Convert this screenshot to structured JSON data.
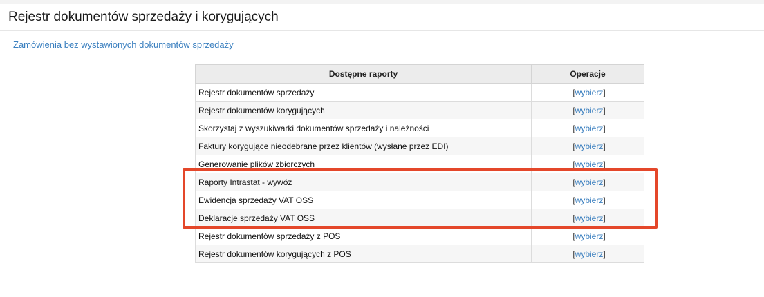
{
  "page": {
    "title": "Rejestr dokumentów sprzedaży i korygujących",
    "orders_link": "Zamówienia bez wystawionych dokumentów sprzedaży"
  },
  "table": {
    "headers": {
      "reports": "Dostępne raporty",
      "operations": "Operacje"
    },
    "bracket_open": "[",
    "bracket_close": "]",
    "rows": [
      {
        "name": "Rejestr dokumentów sprzedaży",
        "action": "wybierz"
      },
      {
        "name": "Rejestr dokumentów korygujących",
        "action": "wybierz"
      },
      {
        "name": "Skorzystaj z wyszukiwarki dokumentów sprzedaży i należności",
        "action": "wybierz"
      },
      {
        "name": "Faktury korygujące nieodebrane przez klientów (wysłane przez EDI)",
        "action": "wybierz"
      },
      {
        "name": "Generowanie plików zbiorczych",
        "action": "wybierz"
      },
      {
        "name": "Raporty Intrastat - wywóz",
        "action": "wybierz"
      },
      {
        "name": "Ewidencja sprzedaży VAT OSS",
        "action": "wybierz"
      },
      {
        "name": "Deklaracje sprzedaży VAT OSS",
        "action": "wybierz"
      },
      {
        "name": "Rejestr dokumentów sprzedaży z POS",
        "action": "wybierz"
      },
      {
        "name": "Rejestr dokumentów korygujących z POS",
        "action": "wybierz"
      }
    ]
  },
  "colors": {
    "link": "#3a7fbf",
    "highlight": "#e4472a",
    "header_bg": "#ececec"
  }
}
